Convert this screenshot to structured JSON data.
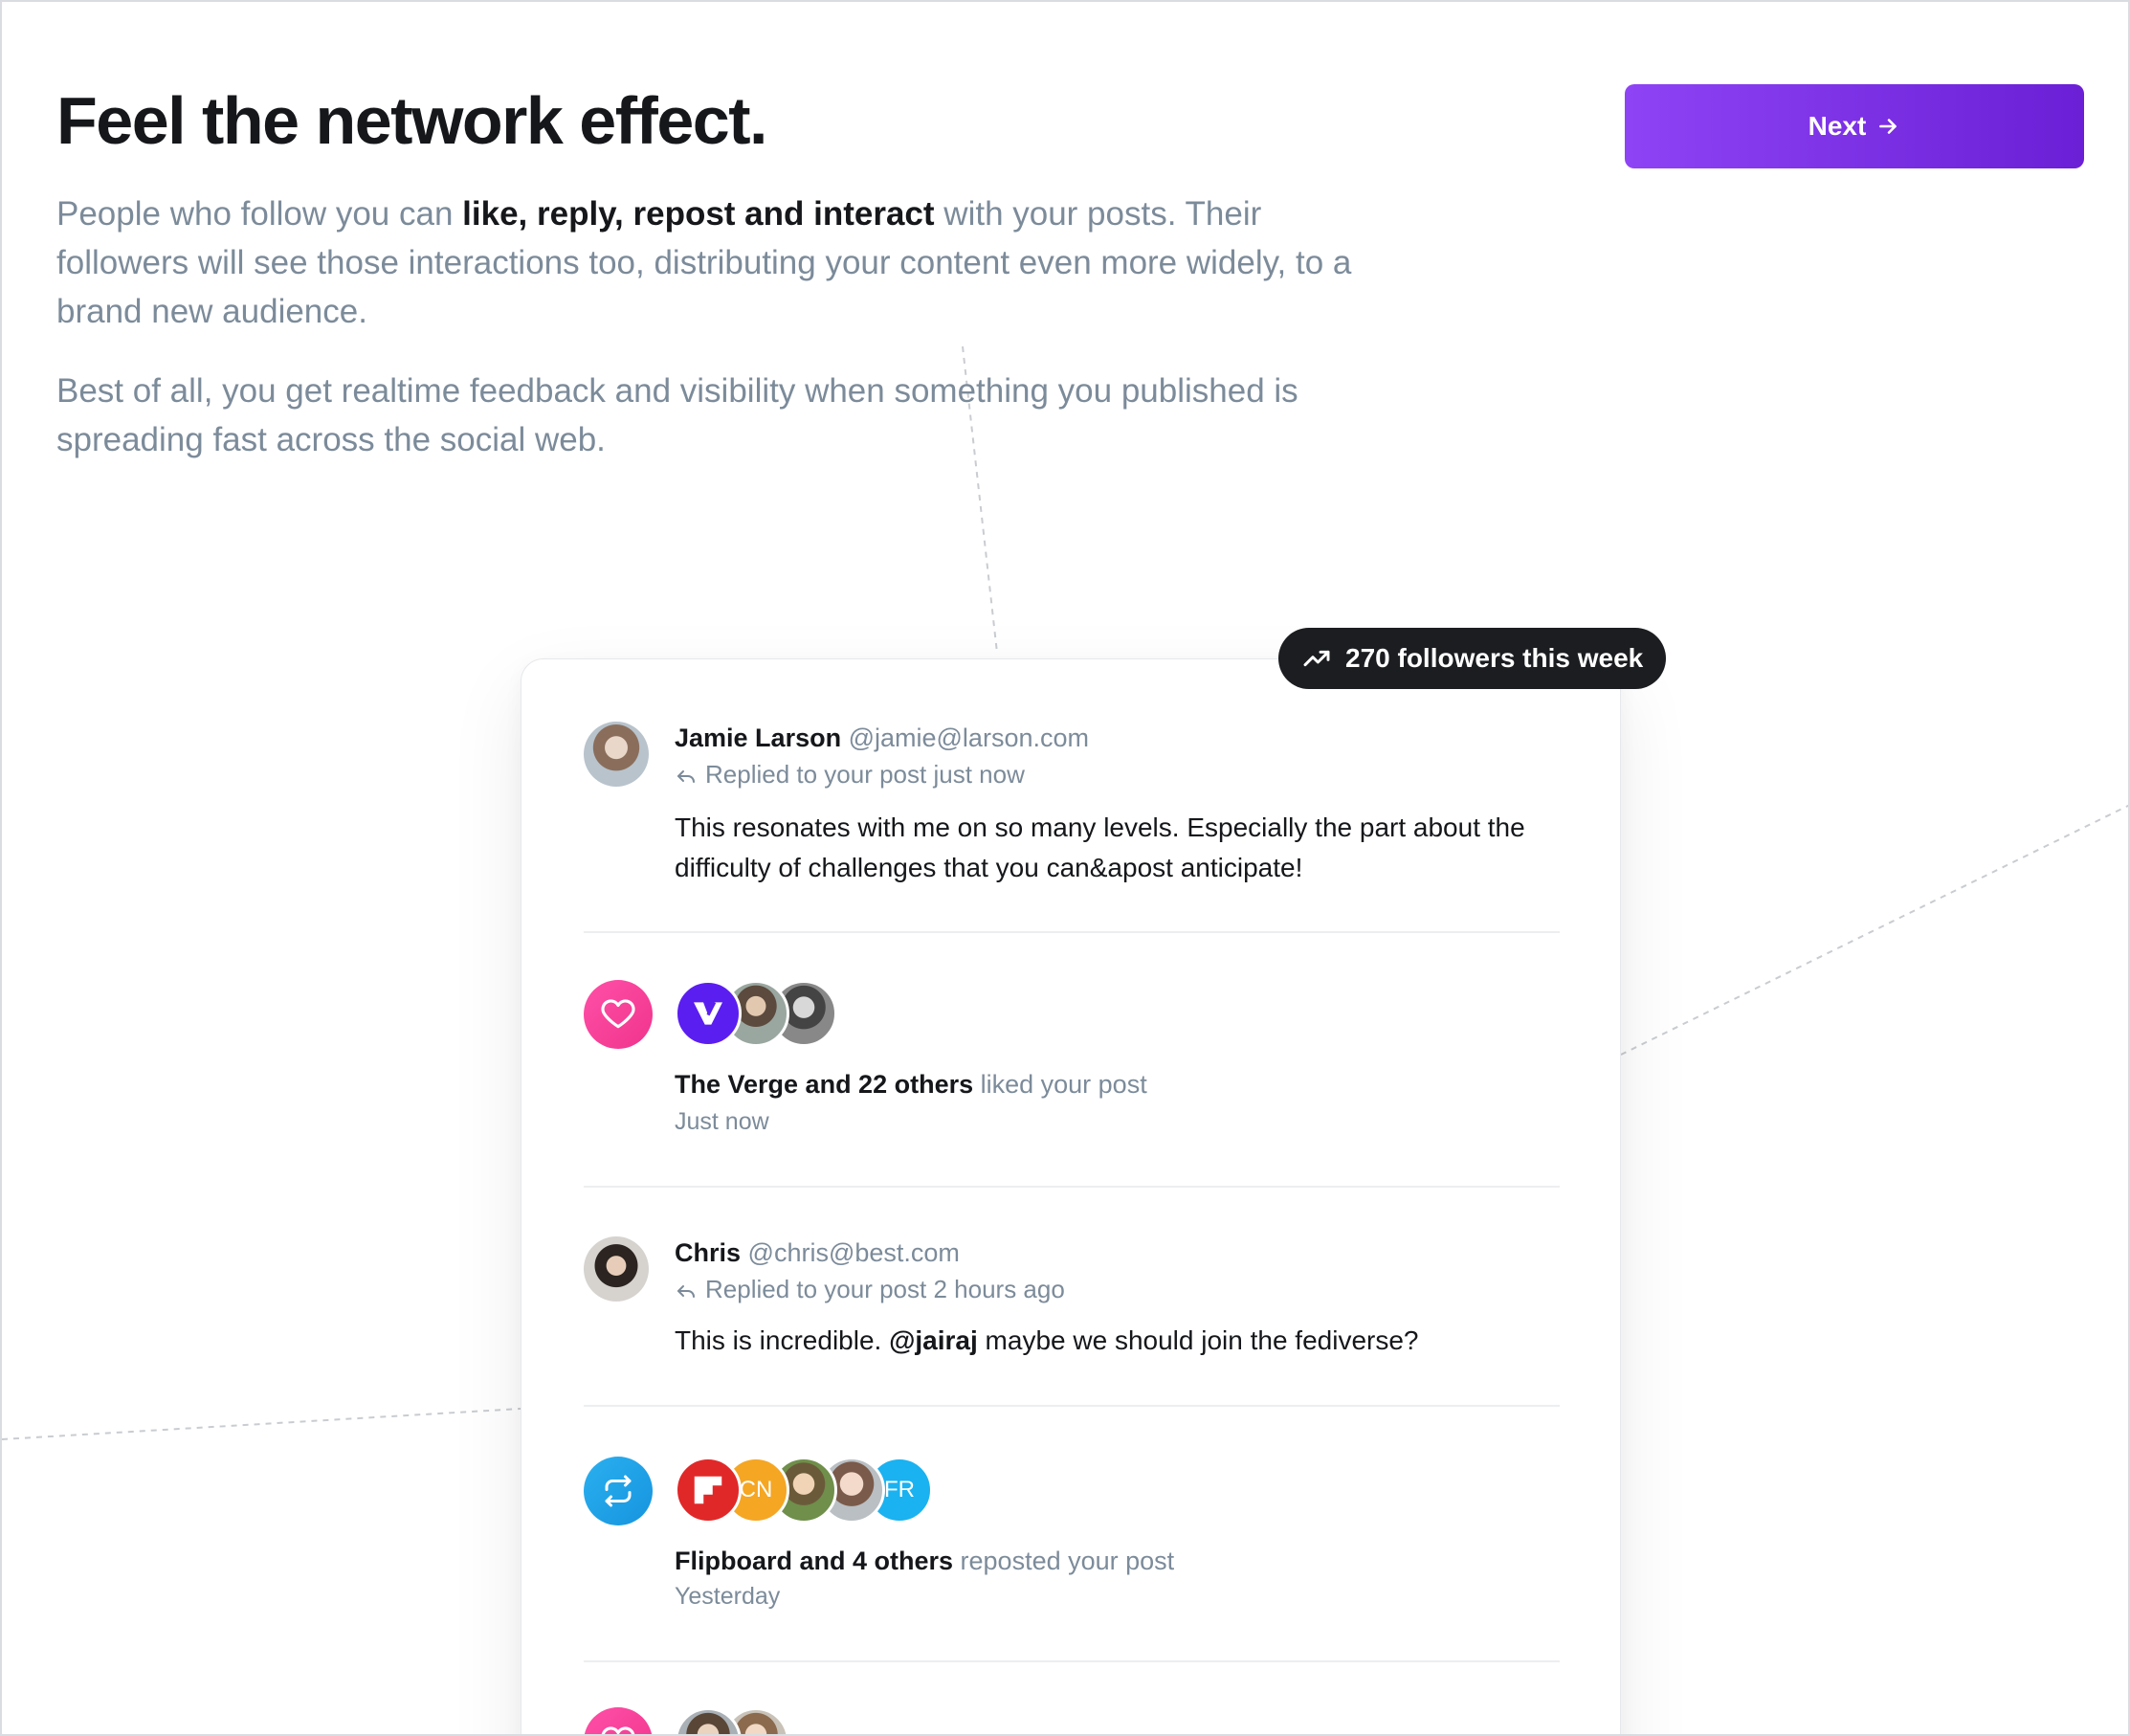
{
  "header": {
    "title": "Feel the network effect.",
    "intro_part1": "People who follow you can ",
    "intro_bold": "like, reply, repost and interact",
    "intro_part2": " with your posts. Their followers will see those interactions too, distributing your content even more widely, to a brand new audience.",
    "intro_second": "Best of all, you get realtime feedback and visibility when something you published is spreading fast across the social web."
  },
  "next_button": {
    "label": "Next",
    "icon": "arrow-right-icon"
  },
  "badge": {
    "icon": "trending-up-icon",
    "label": "270 followers this week"
  },
  "feed": {
    "reply1": {
      "name": "Jamie Larson",
      "handle": "@jamie@larson.com",
      "meta": "Replied to your post just now",
      "text": "This resonates with me on so many levels. Especially the part about the difficulty of challenges that you can&apost anticipate!"
    },
    "like1": {
      "icon": "heart-icon",
      "who": "The Verge and 22 others",
      "what": " liked your post",
      "when": "Just now",
      "colors": {
        "icon_bg": "#f43f9a",
        "verge": "#5b1ef0"
      }
    },
    "reply2": {
      "name": "Chris",
      "handle": "@chris@best.com",
      "meta": "Replied to your post 2 hours ago",
      "text_before": "This is incredible. ",
      "mention": "@jairaj",
      "text_after": " maybe we should join the fediverse?"
    },
    "repost1": {
      "icon": "repost-icon",
      "who": "Flipboard and 4 others",
      "what": " reposted your post",
      "when": "Yesterday",
      "initials_cn": "CN",
      "initials_fr": "FR",
      "colors": {
        "icon_bg": "#1da1e8",
        "flipboard": "#e12828",
        "cn": "#f5a623",
        "fr": "#1ab2f0"
      }
    }
  },
  "colors": {
    "accent": "#7c3aed",
    "muted": "#7c8b9a",
    "text": "#15171a"
  }
}
